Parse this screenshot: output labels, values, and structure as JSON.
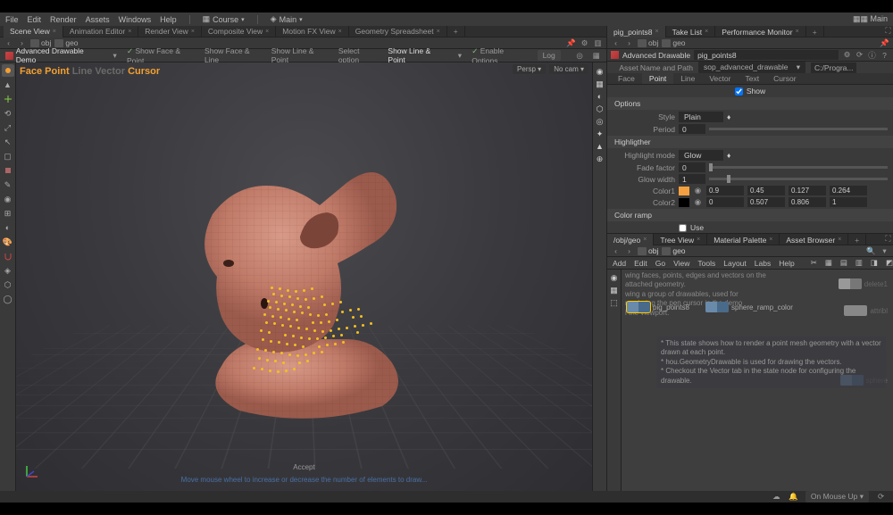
{
  "menu": {
    "items": [
      "File",
      "Edit",
      "Render",
      "Assets",
      "Windows",
      "Help"
    ],
    "drop1": "Course",
    "drop2": "Main",
    "rightLabel": "Main"
  },
  "leftTabs": [
    "Scene View",
    "Animation Editor",
    "Render View",
    "Composite View",
    "Motion FX View",
    "Geometry Spreadsheet"
  ],
  "path": {
    "segs": [
      "obj",
      "geo"
    ]
  },
  "toolbar": {
    "title": "Advanced Drawable Demo",
    "opts": [
      "Show Face & Point",
      "Show Face & Line",
      "Show Line & Point",
      "Select option",
      "Show Line & Point"
    ],
    "enable": "Enable Options",
    "log": "Log"
  },
  "viewport": {
    "overlay": {
      "face": "Face",
      "point": "Point",
      "line": "Line",
      "vector": "Vector",
      "cursor": "Cursor"
    },
    "persp": "Persp",
    "nocam": "No cam",
    "accept": "Accept",
    "hint": "Move mouse wheel to increase or decrease the number of elements to draw..."
  },
  "rightTop": {
    "tabs": [
      "pig_points8",
      "Take List",
      "Performance Monitor"
    ],
    "nodeTitle": "Advanced Drawable",
    "nodeName": "pig_points8",
    "assetLbl": "Asset Name and Path",
    "assetVal": "sop_advanced_drawable",
    "assetPath": "C:/Progra...",
    "paramTabs": [
      "Face",
      "Point",
      "Line",
      "Vector",
      "Text",
      "Cursor"
    ],
    "show": "Show",
    "options": "Options",
    "style": {
      "lbl": "Style",
      "val": "Plain"
    },
    "period": {
      "lbl": "Period",
      "val": "0"
    },
    "highlighter": "Highligther",
    "hmode": {
      "lbl": "Highlight mode",
      "val": "Glow"
    },
    "fade": {
      "lbl": "Fade factor",
      "val": "0"
    },
    "gwidth": {
      "lbl": "Glow width",
      "val": "1"
    },
    "color1": {
      "lbl": "Color1",
      "hex": "#f5a040",
      "v": [
        "0.9",
        "0.45",
        "0.127",
        "0.264"
      ]
    },
    "color2": {
      "lbl": "Color2",
      "hex": "#000000",
      "v": [
        "0",
        "0.507",
        "0.806",
        "1"
      ]
    },
    "ramp": "Color ramp",
    "use": "Use"
  },
  "rightBot": {
    "tabs": [
      "/obj/geo",
      "Tree View",
      "Material Palette",
      "Asset Browser"
    ],
    "pathsegs": [
      "obj",
      "geo"
    ],
    "menu": [
      "Add",
      "Edit",
      "Go",
      "View",
      "Tools",
      "Layout",
      "Labs",
      "Help"
    ],
    "descLines": [
      "wing faces, points, edges and vectors on the attached geometry.",
      "wing a group of drawables, used for rendering the pen cursor in the demo",
      "i the viewport."
    ],
    "noteLines": [
      "* This state shows how to render a point mesh geometry with a vector drawn at each point.",
      "* hou.GeometryDrawable is used for drawing the vectors.",
      "* Checkout the Vector tab in the state node for configuring the drawable."
    ],
    "node1": "pig_points8",
    "node2": "sphere_ramp_color",
    "node3": "delete1",
    "node4": "attribl",
    "node5": "sphere"
  },
  "status": {
    "mode": "On Mouse Up"
  }
}
